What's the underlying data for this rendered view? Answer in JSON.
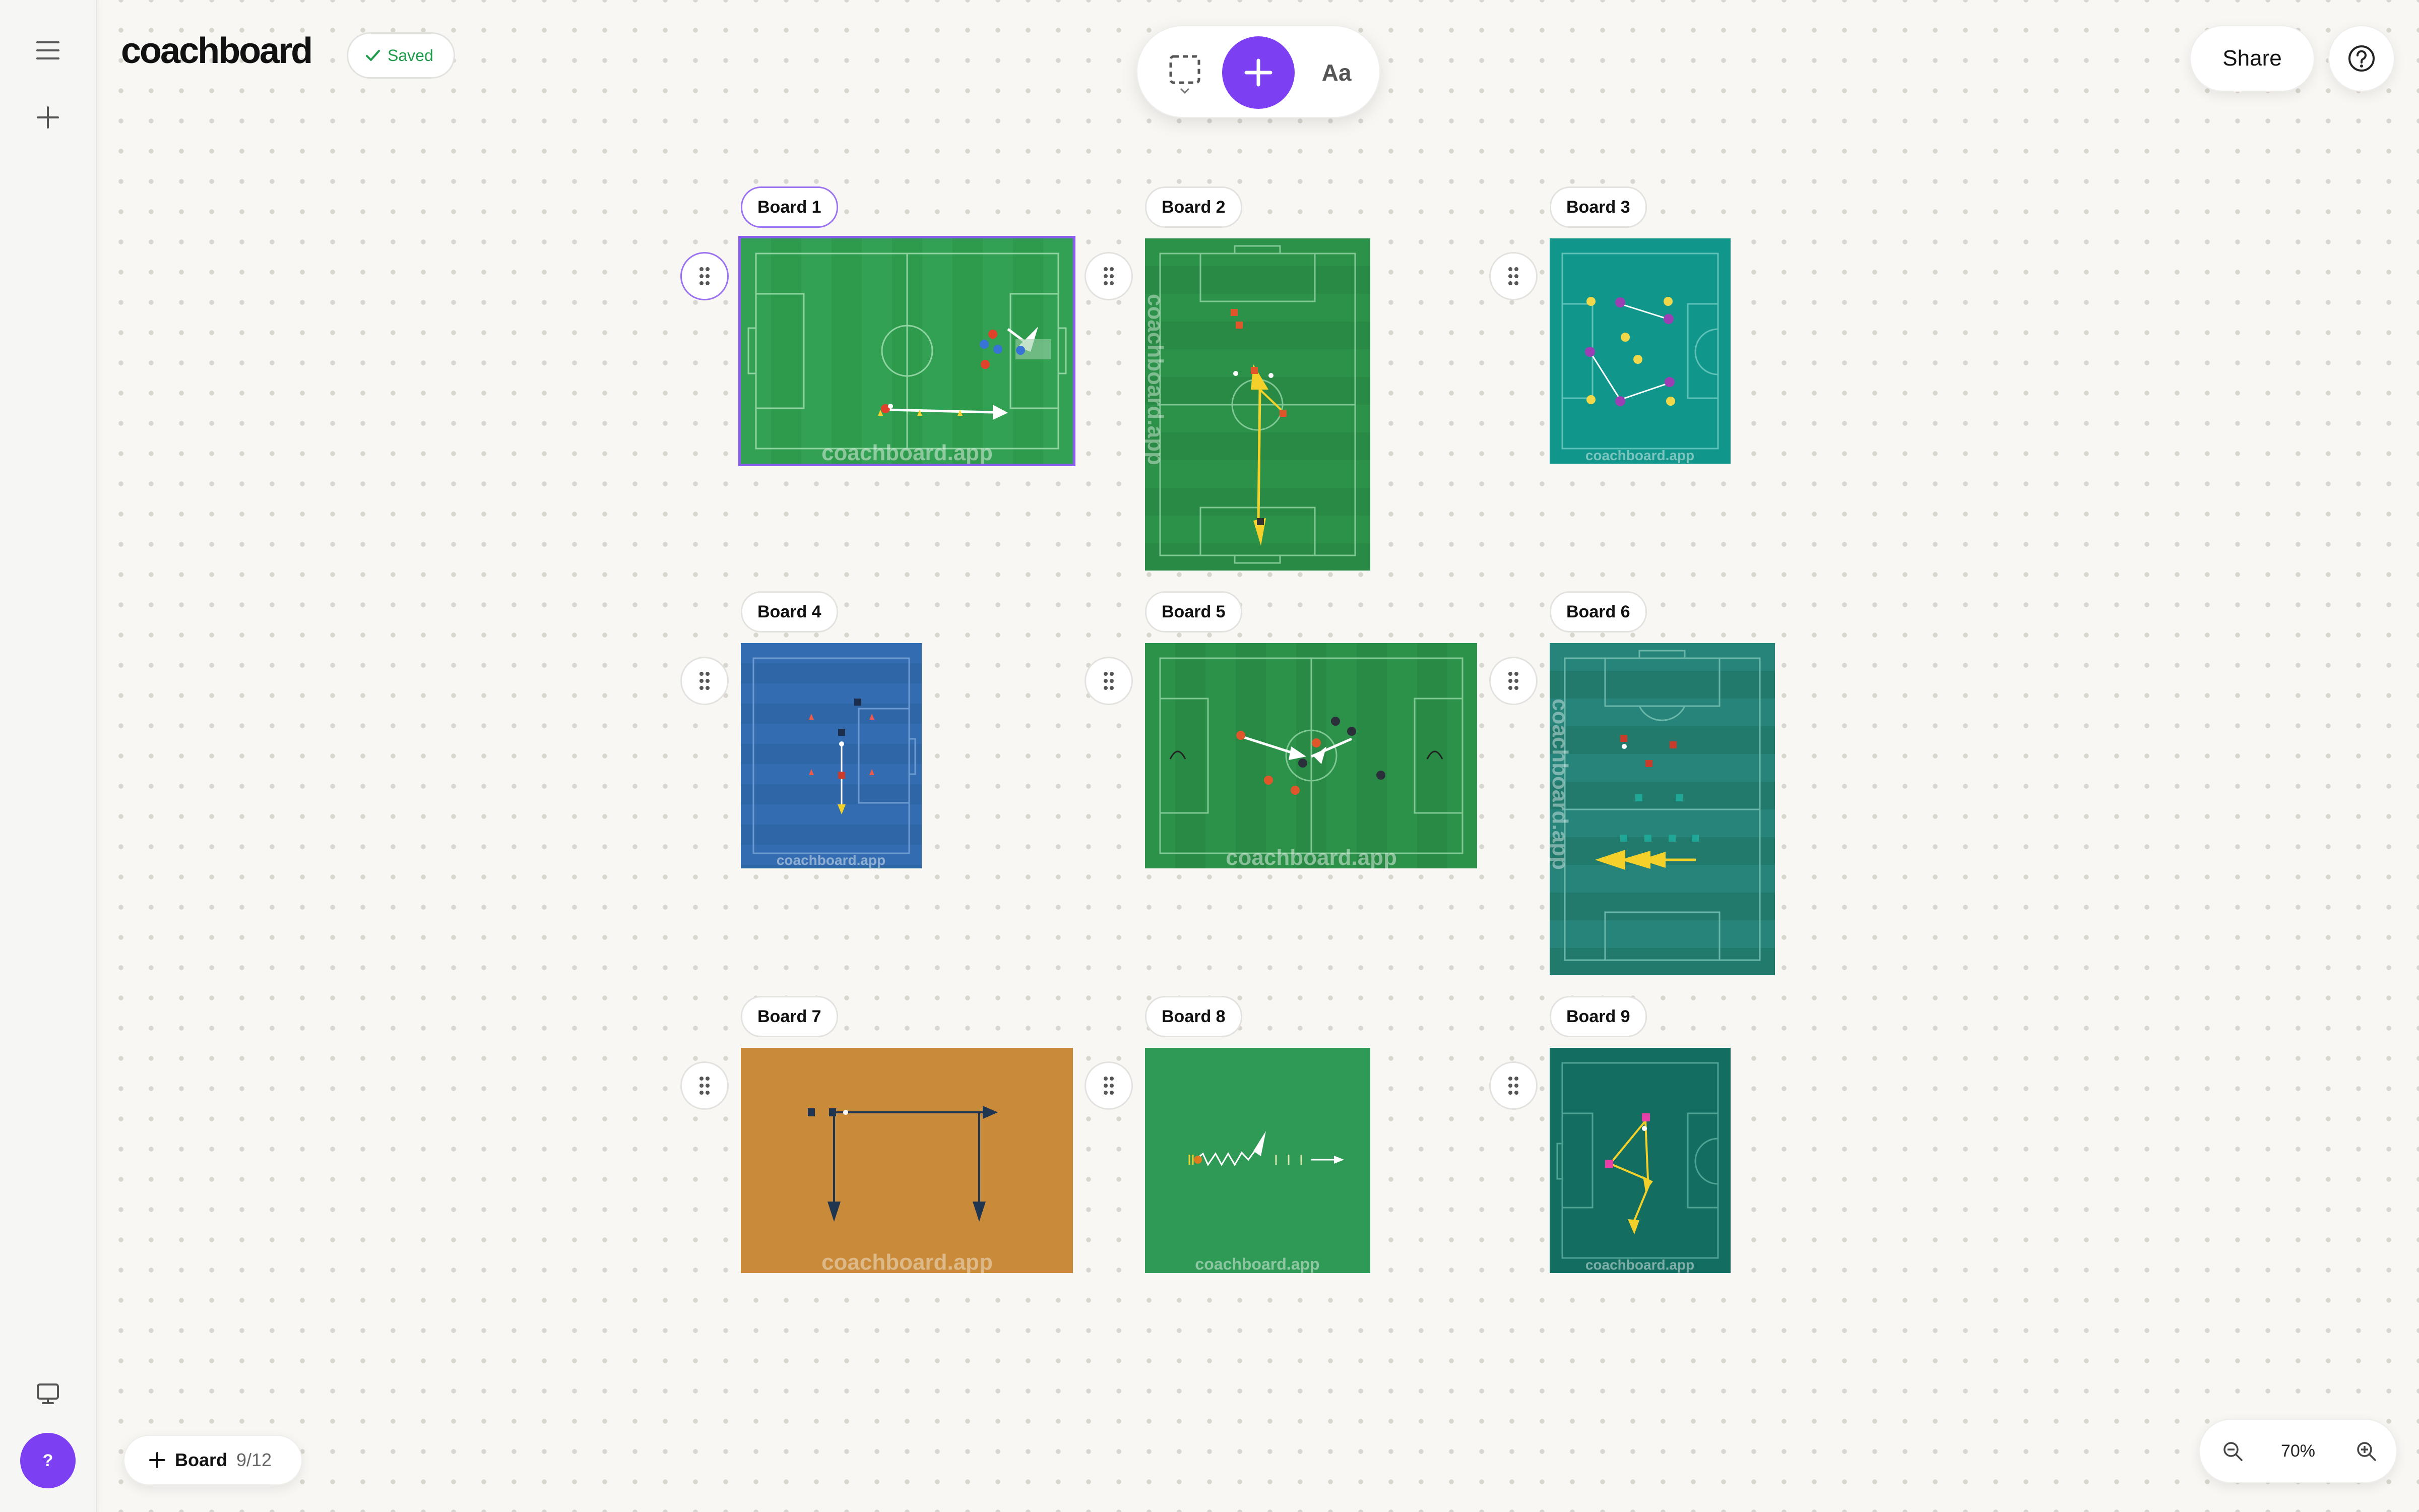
{
  "app": {
    "logo": "coachboard",
    "saved_label": "Saved"
  },
  "toolbar": {
    "text_tool_label": "Aa"
  },
  "header": {
    "share_label": "Share"
  },
  "sidebar": {
    "help_label": "?"
  },
  "boards": [
    {
      "label": "Board 1",
      "watermark": "coachboard.app"
    },
    {
      "label": "Board 2",
      "watermark": "coachboard.app"
    },
    {
      "label": "Board 3",
      "watermark": "coachboard.app"
    },
    {
      "label": "Board 4",
      "watermark": "coachboard.app"
    },
    {
      "label": "Board 5",
      "watermark": "coachboard.app"
    },
    {
      "label": "Board 6",
      "watermark": "coachboard.app"
    },
    {
      "label": "Board 7",
      "watermark": "coachboard.app"
    },
    {
      "label": "Board 8",
      "watermark": "coachboard.app"
    },
    {
      "label": "Board 9",
      "watermark": "coachboard.app"
    }
  ],
  "footer": {
    "add_board_label": "Board",
    "board_count": "9/12"
  },
  "zoom": {
    "value": "70%"
  },
  "colors": {
    "accent": "#7d3ff2",
    "saved_green": "#1f9d4c"
  }
}
